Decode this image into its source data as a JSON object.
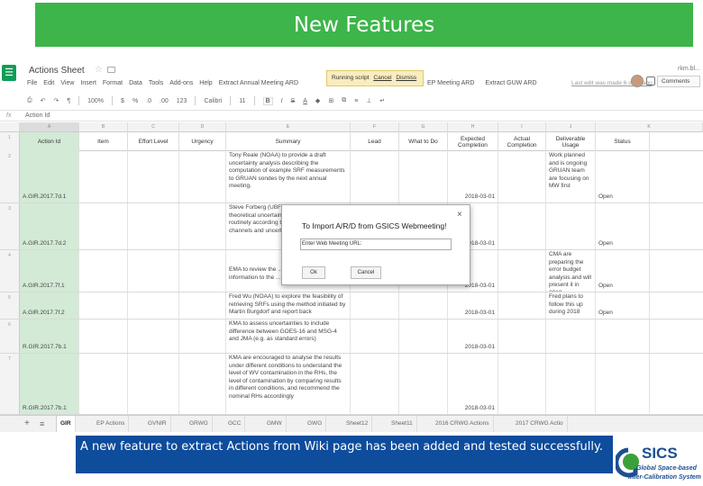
{
  "banner": {
    "title": "New Features"
  },
  "app": {
    "doc_title": "Actions Sheet",
    "owner_label": "rkm.bl...",
    "menu": [
      "File",
      "Edit",
      "View",
      "Insert",
      "Format",
      "Data",
      "Tools",
      "Add-ons",
      "Help",
      "Extract Annual Meeting ARD",
      "Extr"
    ],
    "running_script": {
      "text": "Running script",
      "cancel": "Cancel",
      "dismiss": "Dismiss"
    },
    "addon_menus": [
      "EP Meeting ARD",
      "Extract GUW ARD"
    ],
    "last_edit": "Last edit was made 6 days ago",
    "share_label": "Comments",
    "toolbar": {
      "zoom": "100%",
      "currency": "$",
      "percent": "%",
      "decimals_dec": ".0",
      "decimals_inc": ".00",
      "format_123": "123",
      "font": "Calibri",
      "font_size": "11",
      "bold": "B"
    },
    "formula_bar": {
      "fx": "fx",
      "cell_content": "Action Id"
    }
  },
  "columns": {
    "letters": [
      "A",
      "B",
      "C",
      "D",
      "E",
      "F",
      "G",
      "H",
      "I",
      "J",
      "K"
    ],
    "headers": [
      "Action Id",
      "Item",
      "Effort Level",
      "Urgency",
      "Summary",
      "Lead",
      "What to Do",
      "Expected Completion",
      "Actual Completion",
      "Deliverable Usage",
      "Status"
    ]
  },
  "rows": [
    {
      "num": "2",
      "id": "A.GIR.2017.7d.1",
      "summary": "Tony Reale (NOAA) to provide a draft uncertainty analysis describing the computation of example SRF measurements to GRUAN sondes by the next annual meeting.",
      "expected": "2018-03-01",
      "usage": "Work planned and is ongoing GRUAN team are focusing on MW first",
      "status": "Open"
    },
    {
      "num": "3",
      "id": "A.GIR.2017.7d.2",
      "summary": "Steve Forberg (UBF) to provide the theoretical uncertainty of temperatures routinely according to the selection of the channels and uncertainty analysis according",
      "expected": "2018-03-01",
      "usage": "",
      "status": "Open"
    },
    {
      "num": "4",
      "id": "A.GIR.2017.7f.1",
      "summary": "EMA to review the ... brightness and ... information to the ...",
      "expected": "2018-03-01",
      "usage": "CMA are preparing the error budget analysis and will present it in 2018",
      "status": "Open"
    },
    {
      "num": "5",
      "id": "A.GIR.2017.7f.2",
      "summary": "Fred Wu (NOAA) to explore the feasibility of retrieving SRFs using the method initiated by Martin Burgdorf and report back",
      "expected": "2018-03-01",
      "usage": "Fred plans to follow this up during 2018",
      "status": "Open"
    },
    {
      "num": "6",
      "id": "R.GIR.2017.7b.1",
      "summary": "KMA to assess uncertainties to include difference between GOES-16 and MSG-4 and JMA (e.g. as standard errors)",
      "expected": "2018-03-01",
      "usage": "",
      "status": ""
    },
    {
      "num": "7",
      "id": "R.GIR.2017.7b.1",
      "summary": "KMA are encouraged to analyse the results under different conditions to understand the level of WV contamination in the RHs, the level of contamination by comparing results in different conditions, and recommend the nominal RHs accordingly",
      "expected": "2018-03-01",
      "usage": "",
      "status": ""
    }
  ],
  "tabs": [
    "GIR",
    "EP Actions",
    "GVNIR",
    "GRWG",
    "GCC",
    "GMW",
    "GWG",
    "Sheet12",
    "Sheet11",
    "2016 CRWG Actions",
    "2017 CRWG Actio"
  ],
  "dialog": {
    "title": "To Import A/R/D from GSICS Webmeeting!",
    "label": "Enter Web Meeting URL:",
    "ok": "Ok",
    "cancel": "Cancel",
    "close": "×"
  },
  "caption": "A new feature to extract Actions from Wiki page has been added and tested successfully.",
  "logo": {
    "name": "GSICS",
    "line1": "Global Space-based",
    "line2": "Inter-Calibration System"
  },
  "colors": {
    "banner": "#3db54a",
    "caption_bg": "#0e4c9c",
    "id_col": "#d3ead6",
    "logo_blue": "#1d4f91",
    "logo_green": "#3aa13a"
  }
}
